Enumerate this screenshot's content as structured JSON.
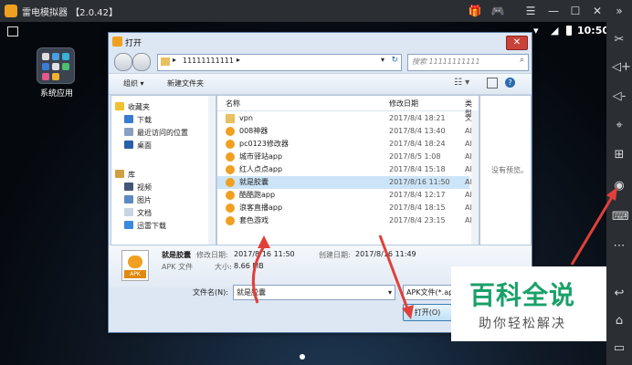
{
  "emulator": {
    "title": "雷电模拟器",
    "version": "【2.0.42】",
    "clock": "10:50",
    "app_label": "系统应用"
  },
  "dialog": {
    "title": "打开",
    "address": "11111111111",
    "search_placeholder": "搜索 11111111111",
    "toolbar": {
      "organize": "组织 ▾",
      "new_folder": "新建文件夹"
    },
    "nav": {
      "favorites": "收藏夹",
      "downloads": "下载",
      "recent": "最近访问的位置",
      "desktop": "桌面",
      "libraries": "库",
      "videos": "视频",
      "pictures": "图片",
      "documents": "文档",
      "xunlei": "迅雷下载"
    },
    "columns": {
      "name": "名称",
      "date": "修改日期",
      "type": "类型"
    },
    "files": [
      {
        "name": "vpn",
        "date": "2017/8/4 18:21",
        "type": "文件"
      },
      {
        "name": "008神器",
        "date": "2017/8/4 13:40",
        "type": "APK"
      },
      {
        "name": "pc0123修改器",
        "date": "2017/8/4 18:24",
        "type": "APK"
      },
      {
        "name": "城市驿站app",
        "date": "2017/8/5 1:08",
        "type": "APK"
      },
      {
        "name": "红人点点app",
        "date": "2017/8/4 15:18",
        "type": "APK"
      },
      {
        "name": "就是胶囊",
        "date": "2017/8/16 11:50",
        "type": "APK"
      },
      {
        "name": "酷酷跑app",
        "date": "2017/8/4 12:17",
        "type": "APK"
      },
      {
        "name": "浪客直播app",
        "date": "2017/8/4 18:15",
        "type": "APK"
      },
      {
        "name": "套色游戏",
        "date": "2017/8/4 23:15",
        "type": "APK"
      }
    ],
    "preview_text": "没有预览。",
    "details": {
      "name": "就是胶囊",
      "modified_label": "修改日期:",
      "modified": "2017/8/16 11:50",
      "created_label": "创建日期:",
      "created": "2017/8/16 11:49",
      "kind": "APK 文件",
      "size_label": "大小:",
      "size": "8.66 MB",
      "icon_text": "APK"
    },
    "filename_label": "文件名(N):",
    "filename_value": "就是胶囊",
    "filetype_value": "APK文件(*.ap",
    "open_label": "打开(O)"
  },
  "watermark": {
    "big": "百科全说",
    "small": "助你轻松解决"
  },
  "colors": {
    "accent": "#1aa06a",
    "arrow": "#e0403a",
    "selection": "#cce4f7"
  }
}
